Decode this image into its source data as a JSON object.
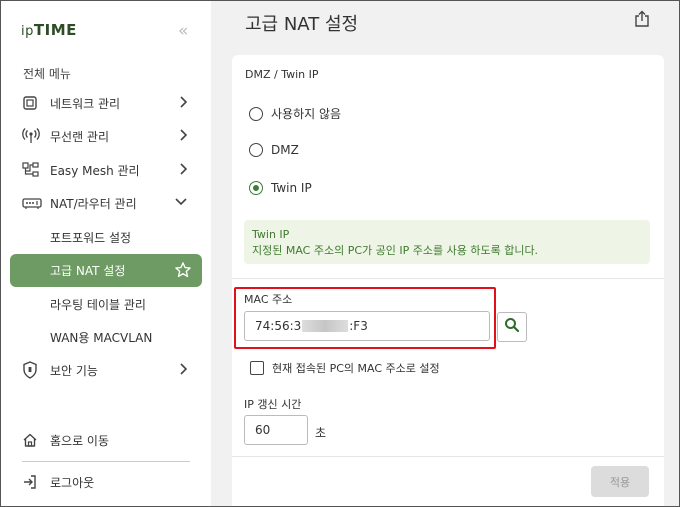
{
  "sidebar": {
    "logo_prefix": "ip",
    "logo_main": "TIME",
    "menu_title": "전체 메뉴",
    "items": [
      {
        "label": "네트워크 관리",
        "icon": "network-icon"
      },
      {
        "label": "무선랜 관리",
        "icon": "wireless-icon"
      },
      {
        "label": "Easy Mesh 관리",
        "icon": "mesh-icon"
      },
      {
        "label": "NAT/라우터 관리",
        "icon": "router-icon"
      }
    ],
    "sub_items": [
      {
        "label": "포트포워드 설정"
      },
      {
        "label": "고급 NAT 설정"
      },
      {
        "label": "라우팅 테이블 관리"
      },
      {
        "label": "WAN용 MACVLAN"
      }
    ],
    "security": {
      "label": "보안 기능",
      "icon": "shield-icon"
    },
    "home": {
      "label": "홈으로 이동",
      "icon": "home-icon"
    },
    "logout": {
      "label": "로그아웃",
      "icon": "logout-icon"
    }
  },
  "header": {
    "title": "고급 NAT 설정"
  },
  "main": {
    "section_title": "DMZ / Twin IP",
    "options": [
      {
        "label": "사용하지 않음",
        "selected": false
      },
      {
        "label": "DMZ",
        "selected": false
      },
      {
        "label": "Twin IP",
        "selected": true
      }
    ],
    "info": {
      "title": "Twin IP",
      "text": "지정된 MAC 주소의 PC가 공인 IP 주소를 사용 하도록 합니다."
    },
    "mac": {
      "label": "MAC 주소",
      "value_prefix": "74:56:3",
      "value_suffix": ":F3"
    },
    "checkbox_label": "현재 접속된 PC의 MAC 주소로 설정",
    "renew": {
      "label": "IP 갱신 시간",
      "value": "60",
      "unit": "초"
    },
    "apply_label": "적용"
  },
  "colors": {
    "accent": "#6e9b63",
    "highlight_box": "#e0111b",
    "info_text": "#3f7a2e"
  }
}
